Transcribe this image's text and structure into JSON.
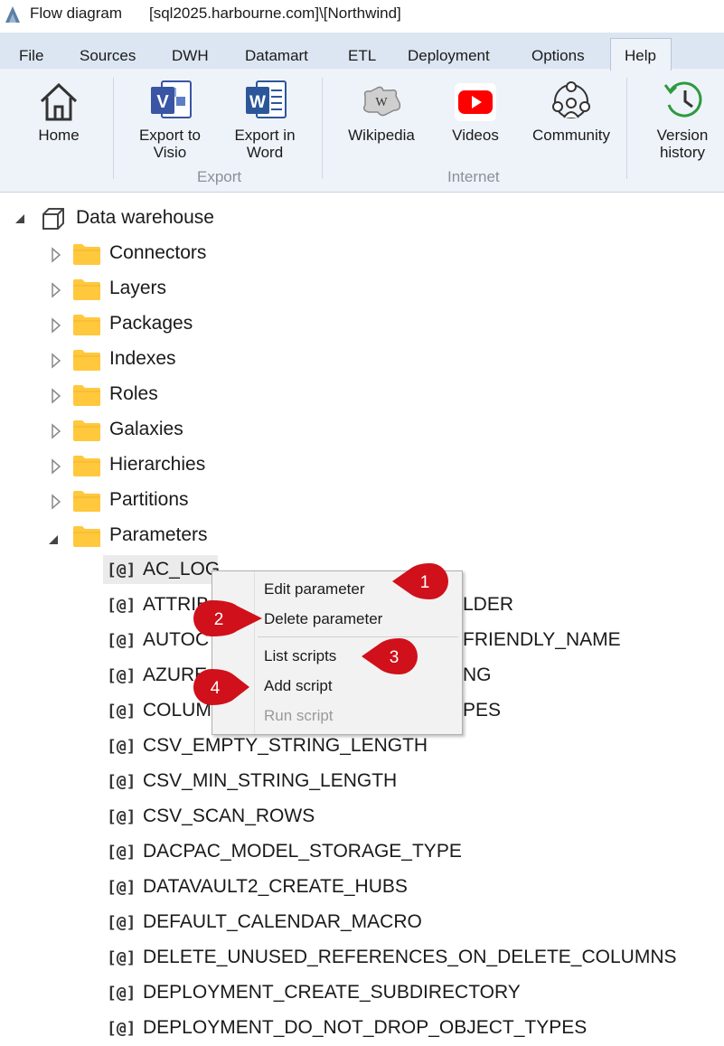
{
  "window": {
    "title": "Flow diagram",
    "connection": "[sql2025.harbourne.com]\\[Northwind]"
  },
  "menu": {
    "items": [
      "File",
      "Sources",
      "DWH",
      "Datamart",
      "ETL",
      "Deployment",
      "Options",
      "Help"
    ],
    "active": "Help"
  },
  "ribbon": {
    "home": "Home",
    "export_visio": [
      "Export to",
      "Visio"
    ],
    "export_word": [
      "Export in",
      "Word"
    ],
    "wikipedia": "Wikipedia",
    "videos": "Videos",
    "community": "Community",
    "version_history": [
      "Version",
      "history"
    ],
    "group_export": "Export",
    "group_internet": "Internet"
  },
  "tree": {
    "root": "Data warehouse",
    "folders": [
      "Connectors",
      "Layers",
      "Packages",
      "Indexes",
      "Roles",
      "Galaxies",
      "Hierarchies",
      "Partitions",
      "Parameters"
    ],
    "param_prefix": "[@]",
    "parameters": [
      "AC_LOG",
      "ATTRIB",
      "LDER",
      "AUTOC",
      "FRIENDLY_NAME",
      "AZURE",
      "NG",
      "COLUM",
      "PES",
      "CSV_EMPTY_STRING_LENGTH",
      "CSV_MIN_STRING_LENGTH",
      "CSV_SCAN_ROWS",
      "DACPAC_MODEL_STORAGE_TYPE",
      "DATAVAULT2_CREATE_HUBS",
      "DEFAULT_CALENDAR_MACRO",
      "DELETE_UNUSED_REFERENCES_ON_DELETE_COLUMNS",
      "DEPLOYMENT_CREATE_SUBDIRECTORY",
      "DEPLOYMENT_DO_NOT_DROP_OBJECT_TYPES"
    ]
  },
  "context_menu": {
    "edit": "Edit parameter",
    "delete": "Delete parameter",
    "list": "List scripts",
    "add": "Add script",
    "run": "Run script"
  },
  "callouts": [
    "1",
    "2",
    "3",
    "4"
  ],
  "colors": {
    "callout": "#d0101a",
    "folder": "#ffc83d",
    "accent": "#2b579a"
  }
}
